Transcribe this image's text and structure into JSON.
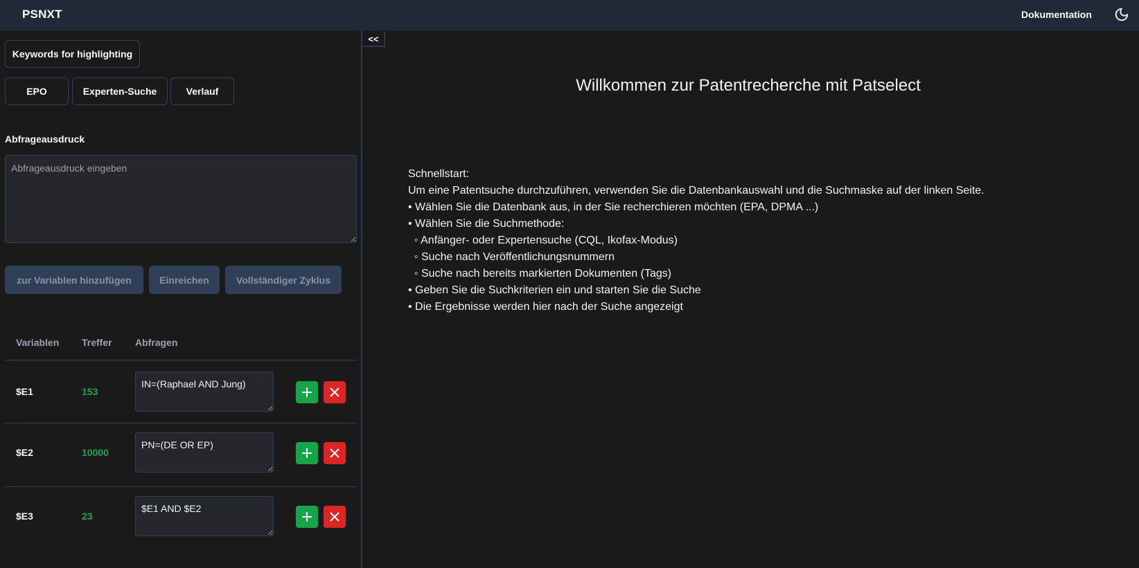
{
  "header": {
    "brand": "PSNXT",
    "doc_link": "Dokumentation",
    "theme_icon": "moon-icon"
  },
  "sidebar": {
    "keywords_button": "Keywords for highlighting",
    "tabs": [
      {
        "label": "EPO"
      },
      {
        "label": "Experten-Suche"
      },
      {
        "label": "Verlauf"
      }
    ],
    "query_label": "Abfrageausdruck",
    "query_value": "",
    "query_placeholder": "Abfrageausdruck eingeben",
    "actions": {
      "add_variable": "zur Variablen hinzufügen",
      "submit": "Einreichen",
      "full_cycle": "Vollständiger Zyklus"
    },
    "table": {
      "headers": [
        "Variablen",
        "Treffer",
        "Abfragen"
      ],
      "rows": [
        {
          "variable": "$E1",
          "hits": "153",
          "query": "IN=(Raphael AND Jung)"
        },
        {
          "variable": "$E2",
          "hits": "10000",
          "query": "PN=(DE OR EP)"
        },
        {
          "variable": "$E3",
          "hits": "23",
          "query": "$E1 AND $E2"
        }
      ]
    },
    "collapse_label": "<<"
  },
  "main": {
    "title": "Willkommen zur Patentrecherche mit Patselect",
    "lines": [
      "Schnellstart:",
      "Um eine Patentsuche durchzuführen, verwenden Sie die Datenbankauswahl und die Suchmaske auf der linken Seite.",
      "• Wählen Sie die Datenbank aus, in der Sie recherchieren möchten (EPA, DPMA ...)",
      "• Wählen Sie die Suchmethode:",
      "  ◦ Anfänger- oder Expertensuche (CQL, Ikofax-Modus)",
      "  ◦ Suche nach Veröffentlichungsnummern",
      "  ◦ Suche nach bereits markierten Dokumenten (Tags)",
      "• Geben Sie die Suchkriterien ein und starten Sie die Suche",
      "• Die Ergebnisse werden hier nach der Suche angezeigt"
    ]
  },
  "colors": {
    "header_bg": "#1f2937",
    "page_bg": "#1a1a1a",
    "hits_green": "#22a34a",
    "add_green": "#16a34a",
    "delete_red": "#dc2626",
    "disabled_button": "#2f3f58"
  }
}
